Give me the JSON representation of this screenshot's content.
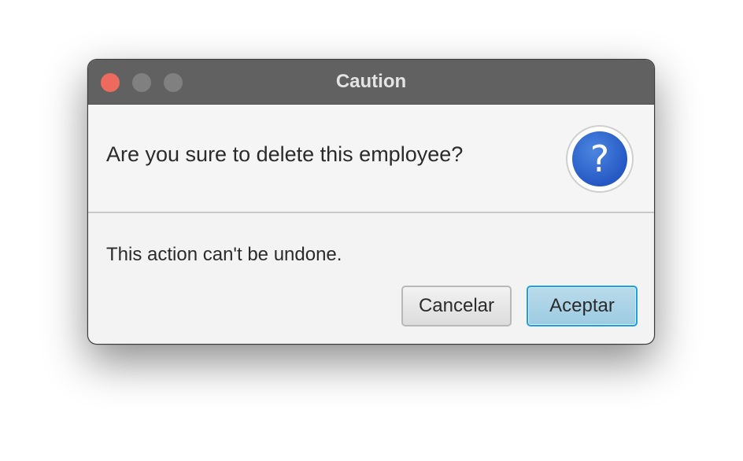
{
  "window": {
    "title": "Caution"
  },
  "dialog": {
    "header_text": "Are you sure to delete this employee?",
    "content_text": "This action can't be undone.",
    "icon_glyph": "?",
    "icon_name": "question-icon"
  },
  "buttons": {
    "cancel_label": "Cancelar",
    "accept_label": "Aceptar"
  },
  "colors": {
    "titlebar": "#616161",
    "close_button": "#ec6a5e",
    "accent_focus": "#1fa0dc",
    "icon_blue": "#2659c4"
  }
}
